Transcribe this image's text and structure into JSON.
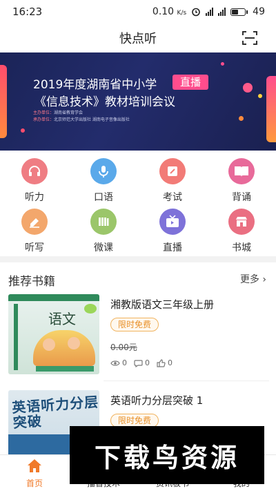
{
  "status_bar": {
    "time": "16:23",
    "speed": "0.10",
    "speed_unit": "K/s",
    "battery": "49"
  },
  "header": {
    "title": "快点听"
  },
  "banner": {
    "line1": "2019年度湖南省中小学",
    "badge": "直播",
    "line2": "《信息技术》教材培训会议",
    "organizer_label": "主办单位：",
    "organizer": "湖南省教育学会",
    "co_label": "承办单位：",
    "co_organizers": "北京师范大学出版社    湖南电子音像出版社"
  },
  "categories": [
    {
      "label": "听力",
      "icon": "headphones-icon",
      "color": "#ef7d83"
    },
    {
      "label": "口语",
      "icon": "microphone-icon",
      "color": "#5aa9ea"
    },
    {
      "label": "考试",
      "icon": "pencil-icon",
      "color": "#f27b77"
    },
    {
      "label": "背诵",
      "icon": "book-icon",
      "color": "#e86a9a"
    },
    {
      "label": "听写",
      "icon": "eraser-icon",
      "color": "#f3a76c"
    },
    {
      "label": "微课",
      "icon": "books-icon",
      "color": "#9bc66a"
    },
    {
      "label": "直播",
      "icon": "tv-icon",
      "color": "#7e72d9"
    },
    {
      "label": "书城",
      "icon": "store-icon",
      "color": "#ea6f82"
    }
  ],
  "recommend": {
    "title": "推荐书籍",
    "more": "更多",
    "books": [
      {
        "title": "湘教版语文三年级上册",
        "tag": "限时免费",
        "price": "0.00元",
        "views": "0",
        "comments": "0",
        "likes": "0",
        "cover_text": "语文"
      },
      {
        "title": "英语听力分层突破 1",
        "tag": "限时免费",
        "cover_text": "英语听力分层突破"
      }
    ]
  },
  "tabbar": {
    "tabs": [
      {
        "label": "首页",
        "active": true
      },
      {
        "label": "播音技术"
      },
      {
        "label": "资讯板书"
      },
      {
        "label": "我的"
      }
    ]
  },
  "watermark": "下载鸟资源"
}
